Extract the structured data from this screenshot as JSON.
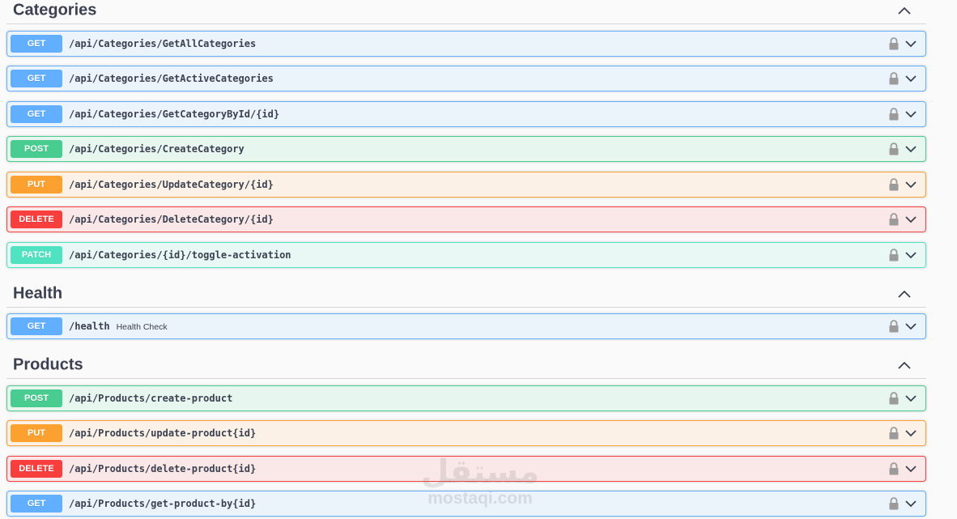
{
  "sections": [
    {
      "title": "Categories",
      "operations": [
        {
          "method": "GET",
          "path": "/api/Categories/GetAllCategories",
          "summary": ""
        },
        {
          "method": "GET",
          "path": "/api/Categories/GetActiveCategories",
          "summary": ""
        },
        {
          "method": "GET",
          "path": "/api/Categories/GetCategoryById/{id}",
          "summary": ""
        },
        {
          "method": "POST",
          "path": "/api/Categories/CreateCategory",
          "summary": ""
        },
        {
          "method": "PUT",
          "path": "/api/Categories/UpdateCategory/{id}",
          "summary": ""
        },
        {
          "method": "DELETE",
          "path": "/api/Categories/DeleteCategory/{id}",
          "summary": ""
        },
        {
          "method": "PATCH",
          "path": "/api/Categories/{id}/toggle-activation",
          "summary": ""
        }
      ]
    },
    {
      "title": "Health",
      "operations": [
        {
          "method": "GET",
          "path": "/health",
          "summary": "Health Check"
        }
      ]
    },
    {
      "title": "Products",
      "operations": [
        {
          "method": "POST",
          "path": "/api/Products/create-product",
          "summary": ""
        },
        {
          "method": "PUT",
          "path": "/api/Products/update-product{id}",
          "summary": ""
        },
        {
          "method": "DELETE",
          "path": "/api/Products/delete-product{id}",
          "summary": ""
        },
        {
          "method": "GET",
          "path": "/api/Products/get-product-by{id}",
          "summary": ""
        }
      ]
    }
  ],
  "icons": {
    "section_toggle": "chevron-up-icon",
    "operation_lock": "lock-icon",
    "operation_expand": "chevron-down-icon"
  },
  "watermark": {
    "arabic": "مستقل",
    "latin": "mostaqi.com"
  },
  "colors": {
    "get": "#61affe",
    "post": "#49cc90",
    "put": "#fca130",
    "delete": "#f93e3e",
    "patch": "#50e3c2",
    "text": "#3b4151"
  }
}
